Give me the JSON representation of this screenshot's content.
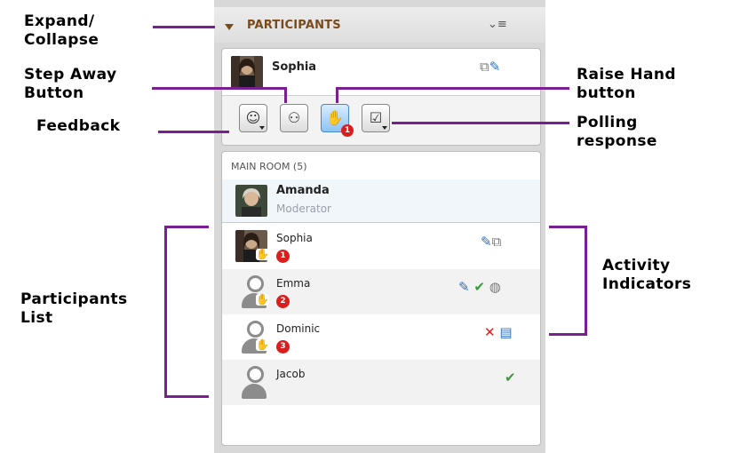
{
  "header": {
    "title": "PARTICIPANTS",
    "expand_icon": "caret-down-icon",
    "menu_icon": "menu-list-icon",
    "menu_glyph": "⌄≡"
  },
  "self": {
    "name": "Sophia",
    "status_icons": [
      "camera-copy-icon",
      "microphone-icon"
    ]
  },
  "action_buttons": [
    {
      "name": "feedback-button",
      "icon": "smiley-icon",
      "glyph": "☺"
    },
    {
      "name": "step-away-button",
      "icon": "step-away-icon",
      "glyph": "⚇"
    },
    {
      "name": "raise-hand-button",
      "icon": "hand-icon",
      "glyph": "✋",
      "badge": "1"
    },
    {
      "name": "polling-button",
      "icon": "checkbox-icon",
      "glyph": "☑"
    }
  ],
  "room": {
    "label": "MAIN ROOM (5)"
  },
  "participants": [
    {
      "name": "Amanda",
      "role": "Moderator"
    },
    {
      "name": "Sophia",
      "hand_order": "1",
      "indicators": [
        "microphone-icon",
        "copy-icon"
      ]
    },
    {
      "name": "Emma",
      "hand_order": "2",
      "indicators": [
        "microphone-icon",
        "check-icon",
        "globe-icon"
      ]
    },
    {
      "name": "Dominic",
      "hand_order": "3",
      "indicators": [
        "x-icon",
        "chat-icon"
      ]
    },
    {
      "name": "Jacob",
      "indicators": [
        "check-icon"
      ]
    }
  ],
  "annotations": {
    "expand_collapse": [
      "Expand/",
      "Collapse"
    ],
    "step_away": [
      "Step Away",
      "Button"
    ],
    "feedback": [
      "Feedback"
    ],
    "raise_hand": [
      "Raise Hand",
      "button"
    ],
    "polling": [
      "Polling",
      "response"
    ],
    "participants_list": [
      "Participants",
      "List"
    ],
    "activity": [
      "Activity",
      "Indicators"
    ]
  },
  "colors": {
    "accent_brown": "#7a4a1a",
    "annotation_line": "#7a1f8f",
    "badge_red": "#d91e1e",
    "mic_blue": "#2e6fc0",
    "check_green": "#3a9a3a"
  }
}
